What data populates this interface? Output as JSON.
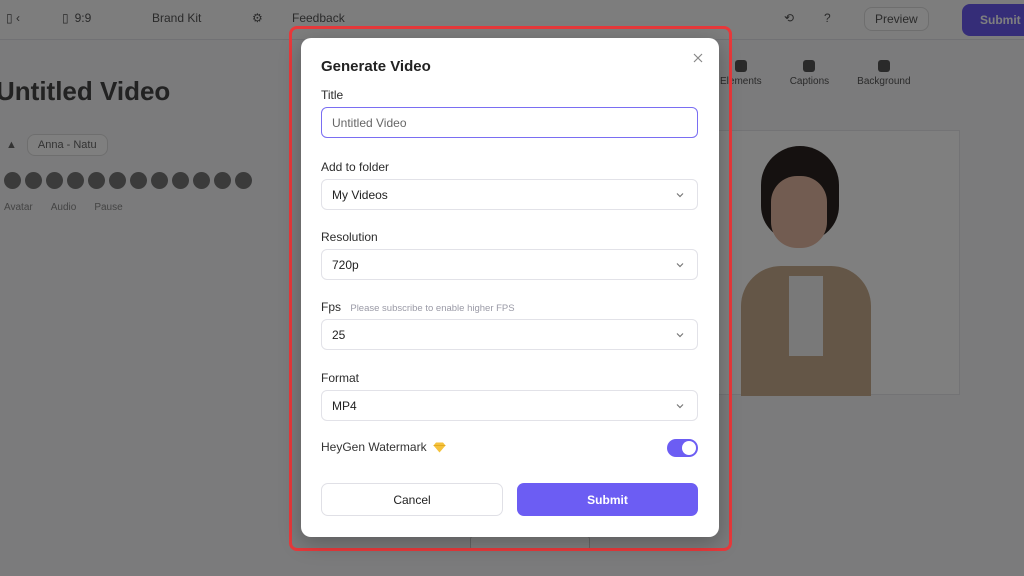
{
  "background": {
    "topbar": {
      "size_value": "9:9",
      "brand_kit": "Brand Kit",
      "feedback": "Feedback",
      "preview": "Preview",
      "submit": "Submit"
    },
    "page_title": "Untitled Video",
    "voice_select": "Anna - Natu",
    "meta": [
      "Avatar",
      "Audio",
      "Pause"
    ],
    "tabs": [
      "Elements",
      "Captions",
      "Background"
    ]
  },
  "modal": {
    "title": "Generate Video",
    "fields": {
      "title": {
        "label": "Title",
        "value": "Untitled Video"
      },
      "folder": {
        "label": "Add to folder",
        "value": "My Videos"
      },
      "resolution": {
        "label": "Resolution",
        "value": "720p"
      },
      "fps": {
        "label": "Fps",
        "hint": "Please subscribe to enable higher FPS",
        "value": "25"
      },
      "format": {
        "label": "Format",
        "value": "MP4"
      }
    },
    "watermark": {
      "label": "HeyGen Watermark",
      "enabled": true
    },
    "buttons": {
      "cancel": "Cancel",
      "submit": "Submit"
    }
  },
  "colors": {
    "accent": "#6c5df3",
    "highlight_frame": "#e8393b",
    "premium_icon": "#f5c23c"
  },
  "icons": [
    "close-icon",
    "chevron-down-icon",
    "diamond-icon"
  ]
}
